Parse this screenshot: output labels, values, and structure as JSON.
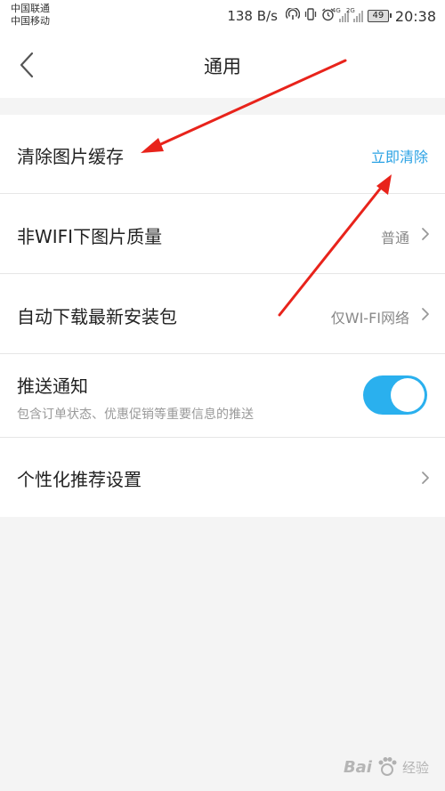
{
  "status_bar": {
    "carrier_1": "中国联通",
    "carrier_2": "中国移动",
    "speed": "138 B/s",
    "net_1": "4G",
    "net_2": "2G",
    "battery": "49",
    "time": "20:38"
  },
  "header": {
    "title": "通用",
    "back_icon": "chevron-left-icon"
  },
  "settings": {
    "clear_cache": {
      "label": "清除图片缓存",
      "action": "立即清除"
    },
    "image_quality": {
      "label": "非WIFI下图片质量",
      "value": "普通"
    },
    "auto_download": {
      "label": "自动下载最新安装包",
      "value": "仅WI-FI网络"
    },
    "push": {
      "label": "推送通知",
      "description": "包含订单状态、优惠促销等重要信息的推送",
      "enabled": true
    },
    "personalization": {
      "label": "个性化推荐设置"
    }
  },
  "colors": {
    "accent": "#2aa2e4",
    "toggle_on": "#2ab0ee",
    "annotation_arrow": "#e8231b"
  },
  "watermark": {
    "brand": "Bai",
    "text": "经验"
  }
}
